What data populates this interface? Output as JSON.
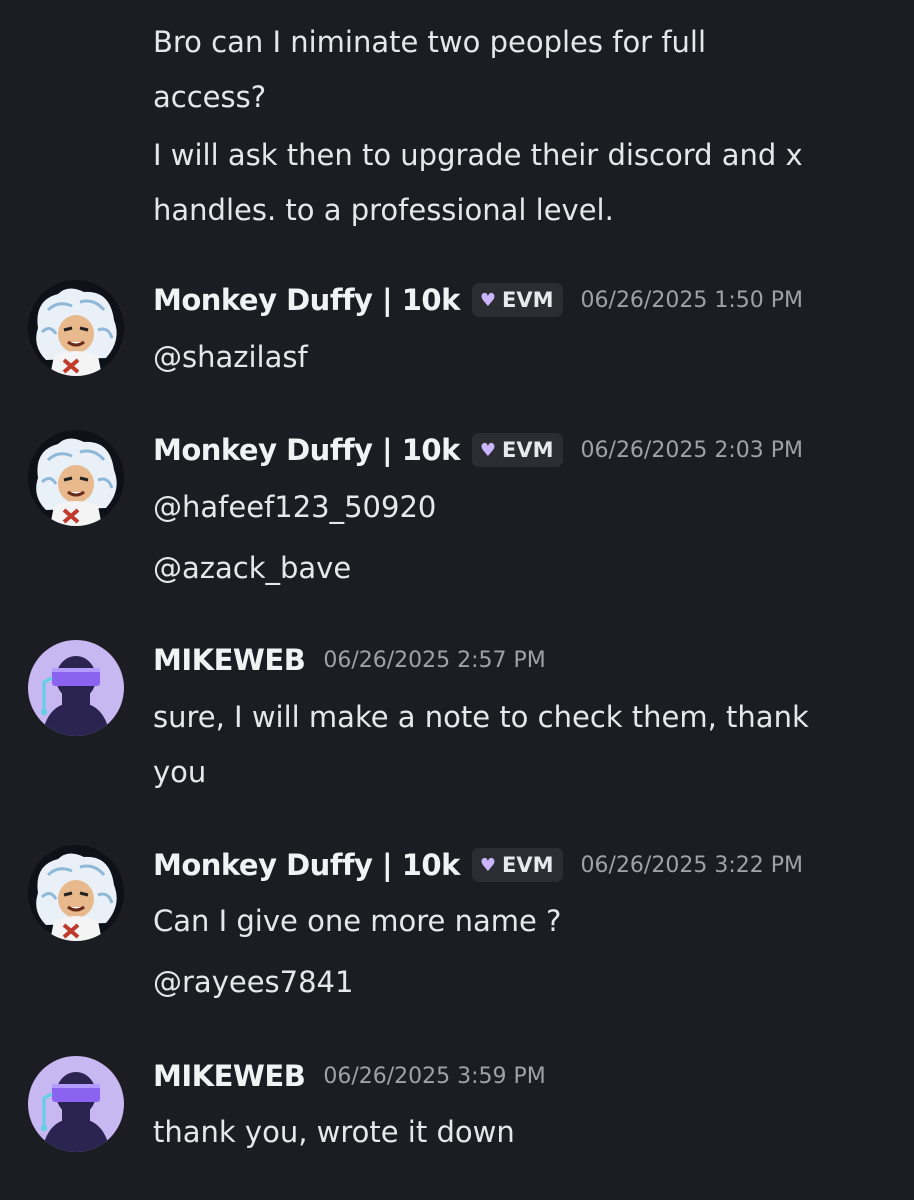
{
  "messages": [
    {
      "lines": [
        "Bro can I niminate two peoples for full",
        "access?",
        "I will ask then to upgrade their discord and x",
        "handles. to a professional level."
      ]
    },
    {
      "username": "Monkey Duffy | 10k",
      "tag": "EVM",
      "time": "06/26/2025 1:50 PM",
      "lines": [
        "@shazilasf"
      ]
    },
    {
      "username": "Monkey Duffy | 10k",
      "tag": "EVM",
      "time": "06/26/2025 2:03 PM",
      "lines": [
        "@hafeef123_50920",
        "@azack_bave"
      ]
    },
    {
      "username": "MIKEWEB",
      "time": "06/26/2025 2:57 PM",
      "lines": [
        "sure, I will make a note to check them, thank",
        "you"
      ]
    },
    {
      "username": "Monkey Duffy | 10k",
      "tag": "EVM",
      "time": "06/26/2025 3:22 PM",
      "lines": [
        "Can I give one more name ?",
        "@rayees7841"
      ]
    },
    {
      "username": "MIKEWEB",
      "time": "06/26/2025 3:59 PM",
      "lines": [
        "thank you, wrote it down"
      ]
    }
  ],
  "icons": {
    "monkey_avatar": "monkey-duffy-avatar-icon",
    "mikeweb_avatar": "mikeweb-avatar-icon",
    "tag_heart": "heart-icon"
  },
  "colors": {
    "background": "#1c1d22",
    "tag_bg": "#2c2d33",
    "heart": "#c9b6ff",
    "timestamp": "#9fa1a8"
  }
}
